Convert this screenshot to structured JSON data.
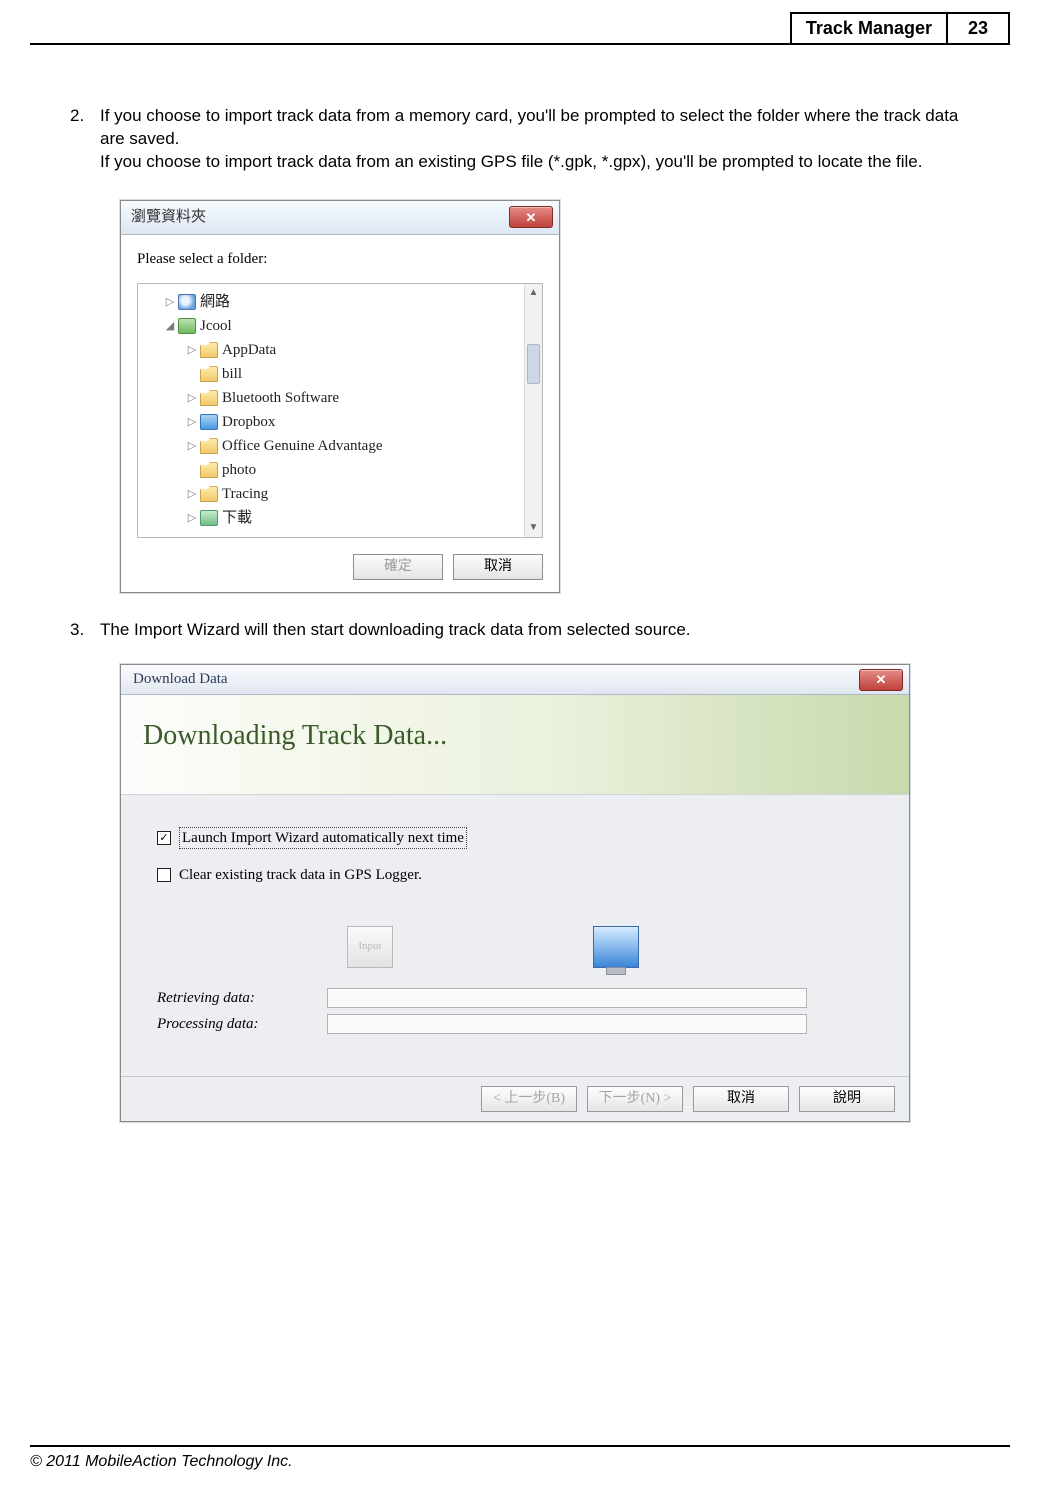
{
  "header": {
    "title": "Track Manager",
    "page_number": "23"
  },
  "step2": {
    "number": "2.",
    "line1": "If you choose to import track data from a memory card, you'll be prompted to select the folder where the track data are saved.",
    "line2": "If you choose to import track data from an existing GPS file (*.gpk, *.gpx), you'll be prompted to locate the file."
  },
  "step3": {
    "number": "3.",
    "line1": "The Import Wizard will then start downloading track data from selected source."
  },
  "folder_dialog": {
    "title": "瀏覽資料夾",
    "label": "Please select a folder:",
    "tree": [
      {
        "indent": 1,
        "twisty": "▷",
        "icon": "net",
        "label": "網路"
      },
      {
        "indent": 1,
        "twisty": "◢",
        "icon": "user",
        "label": "Jcool"
      },
      {
        "indent": 2,
        "twisty": "▷",
        "icon": "folder",
        "label": "AppData"
      },
      {
        "indent": 2,
        "twisty": "",
        "icon": "folder",
        "label": "bill"
      },
      {
        "indent": 2,
        "twisty": "▷",
        "icon": "folder",
        "label": "Bluetooth Software"
      },
      {
        "indent": 2,
        "twisty": "▷",
        "icon": "dropbox",
        "label": "Dropbox"
      },
      {
        "indent": 2,
        "twisty": "▷",
        "icon": "folder",
        "label": "Office Genuine Advantage"
      },
      {
        "indent": 2,
        "twisty": "",
        "icon": "folder",
        "label": "photo"
      },
      {
        "indent": 2,
        "twisty": "▷",
        "icon": "folder",
        "label": "Tracing"
      },
      {
        "indent": 2,
        "twisty": "▷",
        "icon": "dl",
        "label": "下載"
      }
    ],
    "ok_label": "確定",
    "cancel_label": "取消"
  },
  "download_dialog": {
    "title": "Download Data",
    "banner": "Downloading Track Data...",
    "chk_auto_label": "Launch Import Wizard automatically next time",
    "chk_auto_checked": true,
    "chk_clear_label": "Clear existing track data in GPS Logger.",
    "chk_clear_checked": false,
    "field_retrieving": "Retrieving data:",
    "field_processing": "Processing data:",
    "btn_back": "< 上一步(B)",
    "btn_next": "下一步(N) >",
    "btn_cancel": "取消",
    "btn_help": "說明"
  },
  "footer": {
    "copyright": "© 2011 MobileAction Technology Inc."
  }
}
